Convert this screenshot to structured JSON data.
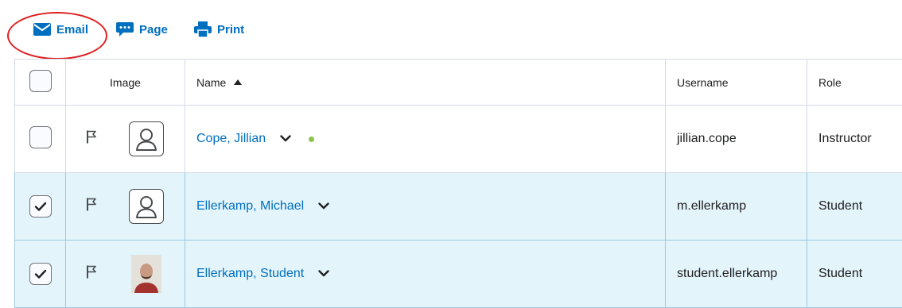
{
  "toolbar": {
    "email_label": "Email",
    "page_label": "Page",
    "print_label": "Print"
  },
  "table": {
    "headers": {
      "image": "Image",
      "name": "Name",
      "username": "Username",
      "role": "Role"
    },
    "rows": [
      {
        "name": "Cope, Jillian",
        "username": "jillian.cope",
        "role": "Instructor",
        "selected": false,
        "online": true,
        "avatar": "placeholder"
      },
      {
        "name": "Ellerkamp, Michael",
        "username": "m.ellerkamp",
        "role": "Student",
        "selected": true,
        "online": false,
        "avatar": "placeholder"
      },
      {
        "name": "Ellerkamp, Student",
        "username": "student.ellerkamp",
        "role": "Student",
        "selected": true,
        "online": false,
        "avatar": "photo"
      }
    ]
  },
  "colors": {
    "link": "#006fbf",
    "selected_row": "#e3f4fb",
    "highlight": "#e02020",
    "online": "#8bc34a"
  },
  "icons": [
    "envelope-icon",
    "chat-bubble-icon",
    "printer-icon",
    "flag-icon",
    "user-placeholder-icon",
    "chevron-down-icon",
    "checkmark-icon"
  ]
}
